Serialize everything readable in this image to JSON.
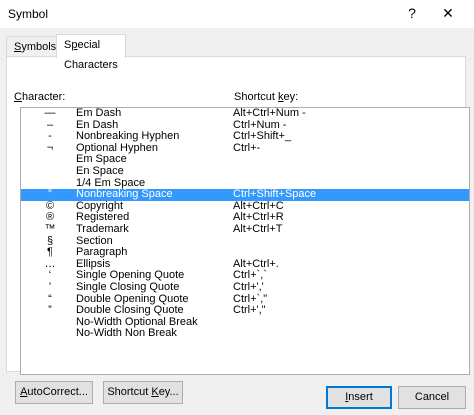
{
  "window": {
    "title": "Symbol",
    "help": "?",
    "close": "✕"
  },
  "tabs": [
    {
      "label_pre": "",
      "label_u": "S",
      "label_post": "ymbols",
      "active": false
    },
    {
      "label_pre": "S",
      "label_u": "p",
      "label_post": "ecial Characters",
      "active": true
    }
  ],
  "columns": {
    "character_pre": "",
    "character_u": "C",
    "character_post": "haracter:",
    "shortcut_pre": "Shortcut ",
    "shortcut_u": "k",
    "shortcut_post": "ey:"
  },
  "rows": [
    {
      "char": "—",
      "name": "Em Dash",
      "shortcut": "Alt+Ctrl+Num -"
    },
    {
      "char": "–",
      "name": "En Dash",
      "shortcut": "Ctrl+Num -"
    },
    {
      "char": "-",
      "name": "Nonbreaking Hyphen",
      "shortcut": "Ctrl+Shift+_"
    },
    {
      "char": "¬",
      "name": "Optional Hyphen",
      "shortcut": "Ctrl+-"
    },
    {
      "char": "",
      "name": "Em Space",
      "shortcut": ""
    },
    {
      "char": "",
      "name": "En Space",
      "shortcut": ""
    },
    {
      "char": "",
      "name": "1/4 Em Space",
      "shortcut": ""
    },
    {
      "char": "°",
      "name": "Nonbreaking Space",
      "shortcut": "Ctrl+Shift+Space",
      "selected": true
    },
    {
      "char": "©",
      "name": "Copyright",
      "shortcut": "Alt+Ctrl+C"
    },
    {
      "char": "®",
      "name": "Registered",
      "shortcut": "Alt+Ctrl+R"
    },
    {
      "char": "™",
      "name": "Trademark",
      "shortcut": "Alt+Ctrl+T"
    },
    {
      "char": "§",
      "name": "Section",
      "shortcut": ""
    },
    {
      "char": "¶",
      "name": "Paragraph",
      "shortcut": ""
    },
    {
      "char": "…",
      "name": "Ellipsis",
      "shortcut": "Alt+Ctrl+."
    },
    {
      "char": "‘",
      "name": "Single Opening Quote",
      "shortcut": "Ctrl+`,`"
    },
    {
      "char": "’",
      "name": "Single Closing Quote",
      "shortcut": "Ctrl+','"
    },
    {
      "char": "“",
      "name": "Double Opening Quote",
      "shortcut": "Ctrl+`,\""
    },
    {
      "char": "”",
      "name": "Double Closing Quote",
      "shortcut": "Ctrl+',\""
    },
    {
      "char": "",
      "name": "No-Width Optional Break",
      "shortcut": ""
    },
    {
      "char": "",
      "name": "No-Width Non Break",
      "shortcut": ""
    }
  ],
  "buttons": {
    "autocorrect_pre": "",
    "autocorrect_u": "A",
    "autocorrect_post": "utoCorrect...",
    "shortcut_pre": "Shortcut ",
    "shortcut_u": "K",
    "shortcut_post": "ey...",
    "insert_pre": "",
    "insert_u": "I",
    "insert_post": "nsert",
    "cancel": "Cancel"
  }
}
